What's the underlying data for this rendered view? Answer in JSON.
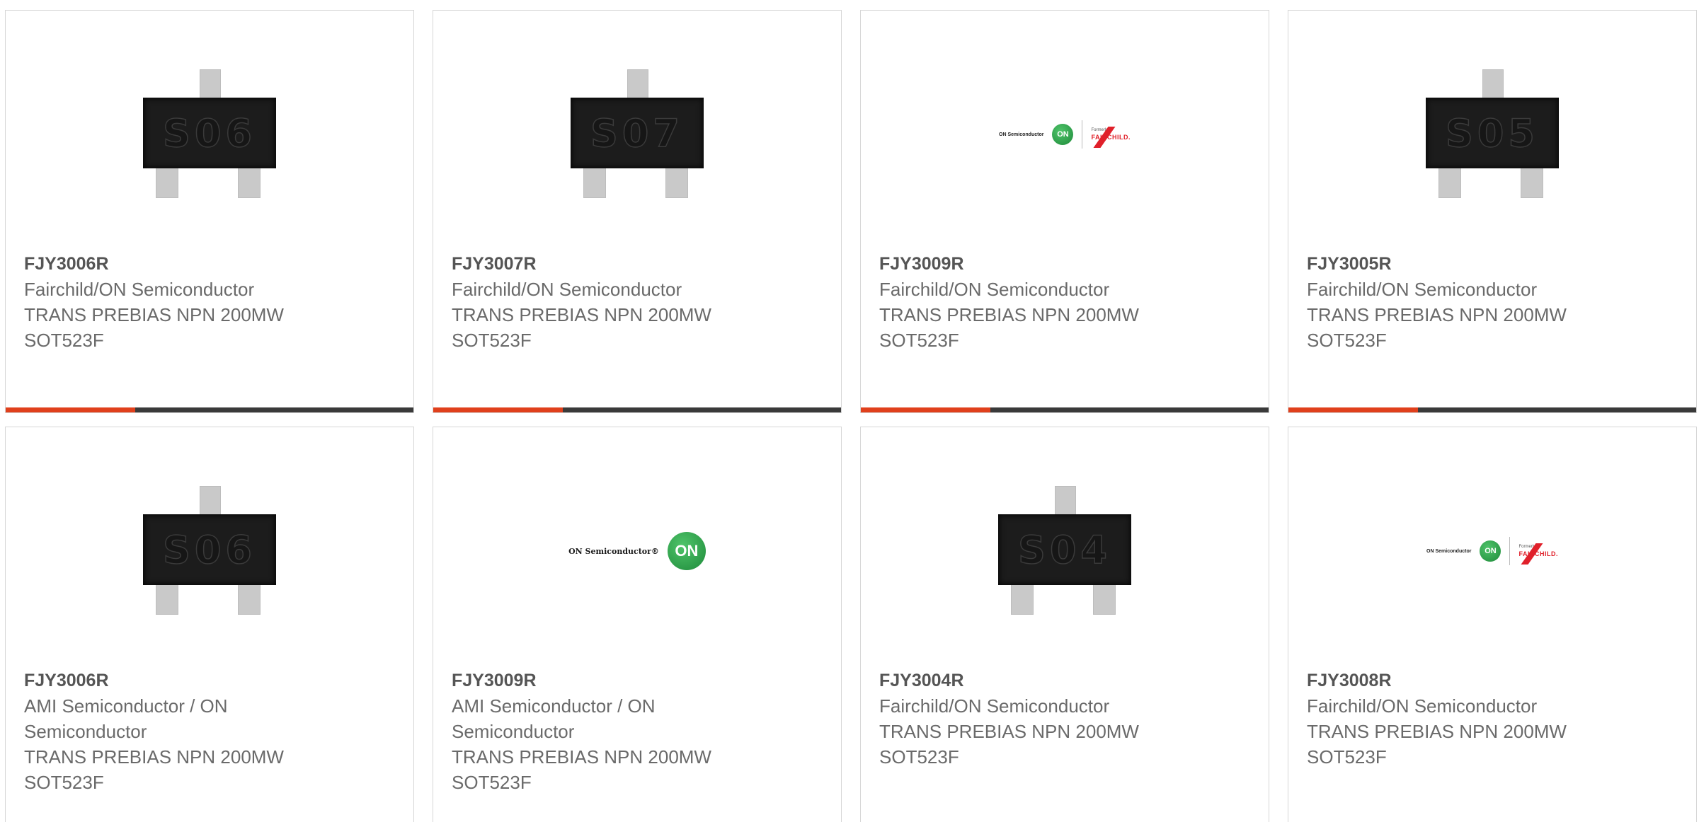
{
  "colors": {
    "accent": "#e0401c",
    "bar": "#3a3a3a",
    "border": "#d6d6d6",
    "text": "#6a6a6a"
  },
  "products": [
    {
      "part_number": "FJY3006R",
      "manufacturer": "Fairchild/ON Semiconductor",
      "description": "TRANS PREBIAS NPN 200MW",
      "package": "SOT523F",
      "image": {
        "type": "chip",
        "marking": "S06"
      }
    },
    {
      "part_number": "FJY3007R",
      "manufacturer": "Fairchild/ON Semiconductor",
      "description": "TRANS PREBIAS NPN 200MW",
      "package": "SOT523F",
      "image": {
        "type": "chip",
        "marking": "S07"
      }
    },
    {
      "part_number": "FJY3009R",
      "manufacturer": "Fairchild/ON Semiconductor",
      "description": "TRANS PREBIAS NPN 200MW",
      "package": "SOT523F",
      "image": {
        "type": "logo-combo",
        "onsemi": "ON Semiconductor",
        "on": "ON",
        "formerly": "Formerly",
        "fairchild": "FAIRCHILD."
      }
    },
    {
      "part_number": "FJY3005R",
      "manufacturer": "Fairchild/ON Semiconductor",
      "description": "TRANS PREBIAS NPN 200MW",
      "package": "SOT523F",
      "image": {
        "type": "chip",
        "marking": "S05"
      }
    },
    {
      "part_number": "FJY3006R",
      "manufacturer": "AMI Semiconductor / ON Semiconductor",
      "description": "TRANS PREBIAS NPN 200MW",
      "package": "SOT523F",
      "image": {
        "type": "chip",
        "marking": "S06"
      }
    },
    {
      "part_number": "FJY3009R",
      "manufacturer": "AMI Semiconductor / ON Semiconductor",
      "description": "TRANS PREBIAS NPN 200MW",
      "package": "SOT523F",
      "image": {
        "type": "logo-on",
        "onsemi": "ON Semiconductor®",
        "on": "ON"
      }
    },
    {
      "part_number": "FJY3004R",
      "manufacturer": "Fairchild/ON Semiconductor",
      "description": "TRANS PREBIAS NPN 200MW",
      "package": "SOT523F",
      "image": {
        "type": "chip",
        "marking": "S04"
      }
    },
    {
      "part_number": "FJY3008R",
      "manufacturer": "Fairchild/ON Semiconductor",
      "description": "TRANS PREBIAS NPN 200MW",
      "package": "SOT523F",
      "image": {
        "type": "logo-combo",
        "onsemi": "ON Semiconductor",
        "on": "ON",
        "formerly": "Formerly",
        "fairchild": "FAIRCHILD."
      }
    }
  ]
}
